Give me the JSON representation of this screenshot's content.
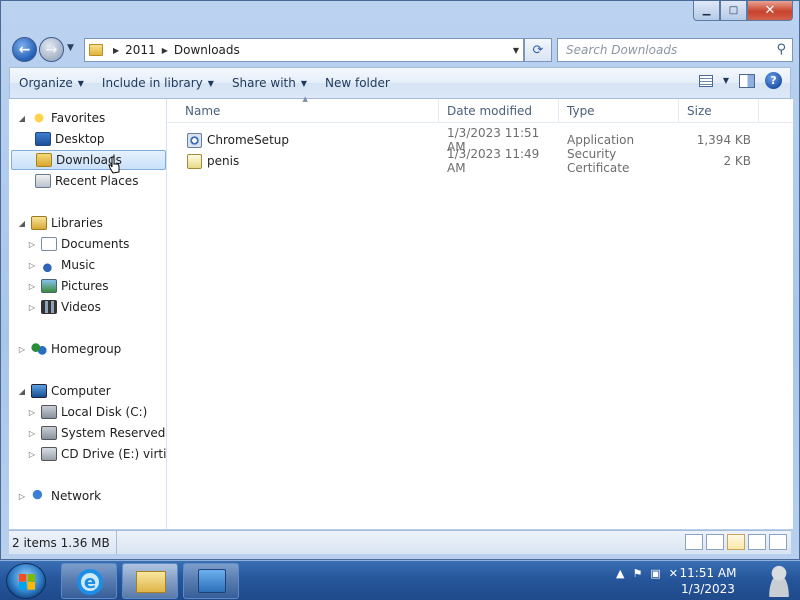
{
  "window": {
    "caption_buttons": {
      "minimize": "▁",
      "maximize": "□",
      "close": "✕"
    }
  },
  "address": {
    "crumbs": [
      "2011",
      "Downloads"
    ],
    "search_placeholder": "Search Downloads"
  },
  "toolbar": {
    "organize": "Organize",
    "include_in_library": "Include in library",
    "share_with": "Share with",
    "new_folder": "New folder"
  },
  "nav": {
    "favorites": {
      "label": "Favorites",
      "items": [
        "Desktop",
        "Downloads",
        "Recent Places"
      ],
      "selected": "Downloads"
    },
    "libraries": {
      "label": "Libraries",
      "items": [
        "Documents",
        "Music",
        "Pictures",
        "Videos"
      ]
    },
    "homegroup": {
      "label": "Homegroup"
    },
    "computer": {
      "label": "Computer",
      "items": [
        "Local Disk (C:)",
        "System Reserved (D:",
        "CD Drive (E:) virtio-v"
      ]
    },
    "network": {
      "label": "Network"
    }
  },
  "columns": {
    "name": "Name",
    "date": "Date modified",
    "type": "Type",
    "size": "Size"
  },
  "files": [
    {
      "name": "ChromeSetup",
      "date": "1/3/2023 11:51 AM",
      "type": "Application",
      "size": "1,394 KB",
      "icon": "application-icon"
    },
    {
      "name": "penis",
      "date": "1/3/2023 11:49 AM",
      "type": "Security Certificate",
      "size": "2 KB",
      "icon": "certificate-icon"
    }
  ],
  "status": {
    "summary": "2 items 1.36 MB"
  },
  "taskbar": {
    "clock_time": "11:51 AM",
    "clock_date": "1/3/2023"
  }
}
